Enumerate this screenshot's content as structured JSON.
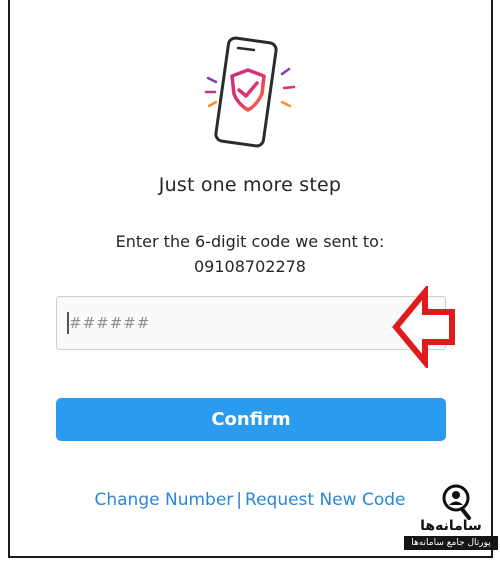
{
  "header": {
    "title": "Just one more step",
    "instruction": "Enter the 6-digit code we sent to:",
    "phone_number": "09108702278"
  },
  "form": {
    "code_placeholder": "######",
    "confirm_label": "Confirm"
  },
  "links": {
    "change_number": "Change Number",
    "separator": "|",
    "request_new_code": "Request New Code"
  },
  "watermark": {
    "title": "سامانه‌ها",
    "subtitle": "پورتال جامع سامانه‌ها"
  },
  "colors": {
    "primary_button": "#2b9bf0",
    "link": "#2a86d6",
    "annotation_arrow": "#e01b1b"
  },
  "icons": {
    "illustration": "phone-shield-check-icon",
    "annotation": "red-arrow-left-icon",
    "watermark": "search-person-icon"
  }
}
